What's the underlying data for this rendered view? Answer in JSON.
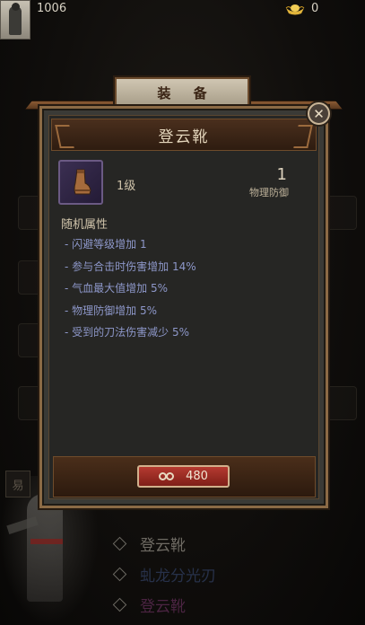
{
  "header": {
    "coins": "1006",
    "ingots": "0"
  },
  "dialog": {
    "tab_label": "装 备",
    "title": "登云靴",
    "close_glyph": "✕",
    "item": {
      "level": "1级",
      "stat_value": "1",
      "stat_name": "物理防御"
    },
    "random_attr_title": "随机属性",
    "attributes": [
      "- 闪避等级增加 1",
      "- 参与合击时伤害增加 14%",
      "- 气血最大值增加 5%",
      "- 物理防御增加 5%",
      "- 受到的刀法伤害减少 5%"
    ],
    "price": "480"
  },
  "background": {
    "side_tag": "易",
    "list": [
      "登云靴",
      "虬龙分光刃",
      "登云靴"
    ]
  },
  "colors": {
    "attribute_text": "#8d97c9",
    "price_button": "#b53a30",
    "frame": "#8b6a45"
  }
}
